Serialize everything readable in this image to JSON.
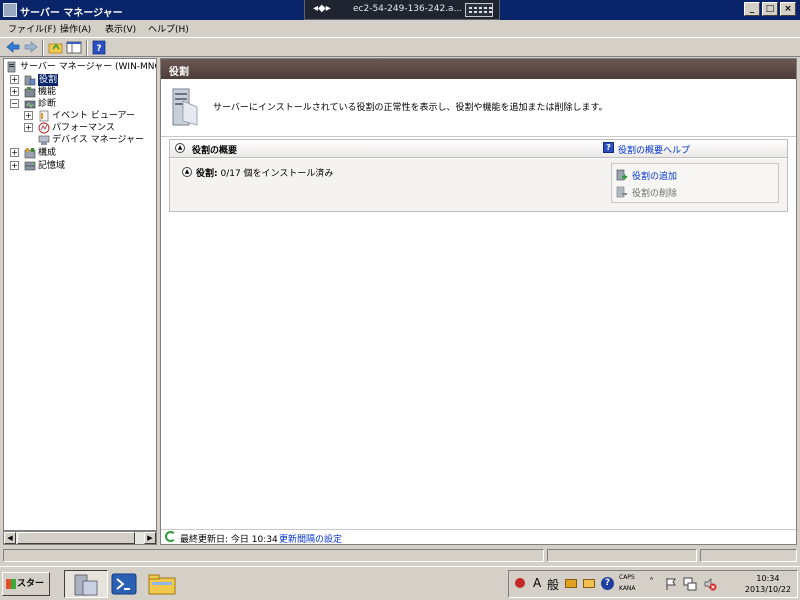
{
  "window": {
    "title": "サーバー マネージャー",
    "rdp_host": "ec2-54-249-136-242.a...",
    "buttons": {
      "minimize": "_",
      "maximize": "□",
      "close": "×"
    }
  },
  "menu": [
    "ファイル(F)",
    "操作(A)",
    "表示(V)",
    "ヘルプ(H)"
  ],
  "toolbar": {
    "buttons": [
      "back-arrow-icon",
      "forward-arrow-icon",
      "up-folder-icon",
      "show-hide-tree-icon",
      "help-icon"
    ]
  },
  "tree": {
    "root": "サーバー マネージャー (WIN-MNOL",
    "items": [
      {
        "label": "役割",
        "selected": true,
        "expander": "+"
      },
      {
        "label": "機能",
        "expander": "+"
      },
      {
        "label": "診断",
        "expander": "−"
      },
      {
        "label": "イベント ビューアー",
        "expander": "+"
      },
      {
        "label": "パフォーマンス",
        "expander": "+"
      },
      {
        "label": "デバイス マネージャー"
      },
      {
        "label": "構成",
        "expander": "+"
      },
      {
        "label": "記憶域",
        "expander": "+"
      }
    ]
  },
  "content": {
    "header": "役割",
    "banner_text": "サーバーにインストールされている役割の正常性を表示し、役割や機能を追加または削除します。",
    "section": {
      "title": "役割の概要",
      "help_link": "役割の概要ヘルプ",
      "roles_label": "役割:",
      "roles_count": "0/17 個をインストール済み",
      "actions": {
        "add": "役割の追加",
        "remove": "役割の削除"
      }
    },
    "status": {
      "last_updated": "最終更新日: 今日 10:34",
      "refresh_settings": "更新間隔の設定"
    }
  },
  "taskbar": {
    "start": "スタート",
    "tray": {
      "ime_a": "A",
      "ime_mode": "般",
      "caps": "CAPS",
      "kana": "KANA"
    },
    "clock": {
      "time": "10:34",
      "date": "2013/10/22"
    }
  }
}
